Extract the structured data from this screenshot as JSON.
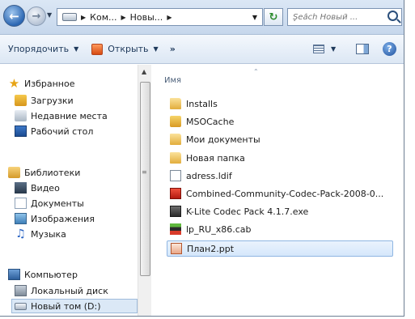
{
  "address": {
    "crumbs": [
      "Ком...",
      "Новы..."
    ],
    "search_placeholder": "Şeắch Новый ..."
  },
  "toolbar": {
    "organize": "Упорядочить",
    "open": "Открыть",
    "more": "»"
  },
  "nav": {
    "favorites": "Избранное",
    "downloads": "Загрузки",
    "recent": "Недавние места",
    "desktop": "Рабочий стол",
    "libraries": "Библиотеки",
    "video": "Видео",
    "documents": "Документы",
    "images": "Изображения",
    "music": "Музыка",
    "computer": "Компьютер",
    "local_disk": "Локальный диск",
    "new_volume": "Новый том (D:)"
  },
  "list": {
    "column_name": "Имя",
    "files": [
      "Installs",
      "MSOCache",
      "Мои документы",
      "Новая папка",
      "adress.ldif",
      "Combined-Community-Codec-Pack-2008-0...",
      "K-Lite Codec Pack 4.1.7.exe",
      "lp_RU_x86.cab",
      "План2.ppt"
    ]
  },
  "colors": {
    "selection_bg": "#d5e7fb",
    "toolbar_text": "#1e395b"
  }
}
